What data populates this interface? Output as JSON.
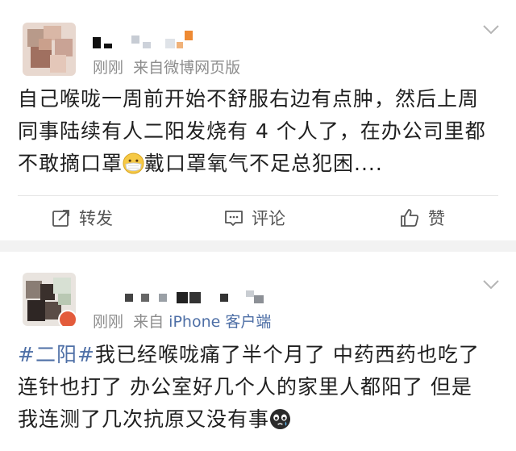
{
  "posts": [
    {
      "time": "刚刚",
      "source": "来自微博网页版",
      "lines": [
        "自己喉咙一周前开始不舒服右边有点肿，然后上周",
        "同事陆续有人二阳发烧有 4 个人了，在办公司里都",
        "不敢摘口罩",
        "戴口罩氧气不足总犯困...."
      ],
      "emoji": "mask-face-icon",
      "actions": {
        "repost": "转发",
        "comment": "评论",
        "like": "赞"
      }
    },
    {
      "time": "刚刚",
      "source_prefix": "来自",
      "source_link": "iPhone 客户端",
      "hashtag": "#二阳#",
      "lines": [
        "我已经喉咙痛了半个月了  中药西药也吃了",
        "连针也打了  办公室好几个人的家里人都阳了  但是",
        "我连测了几次抗原又没有事"
      ],
      "emoji": "crying-face-icon"
    }
  ],
  "colors": {
    "link": "#4e6fa6",
    "meta": "#8d8d8d",
    "text": "#1f1f1f"
  }
}
